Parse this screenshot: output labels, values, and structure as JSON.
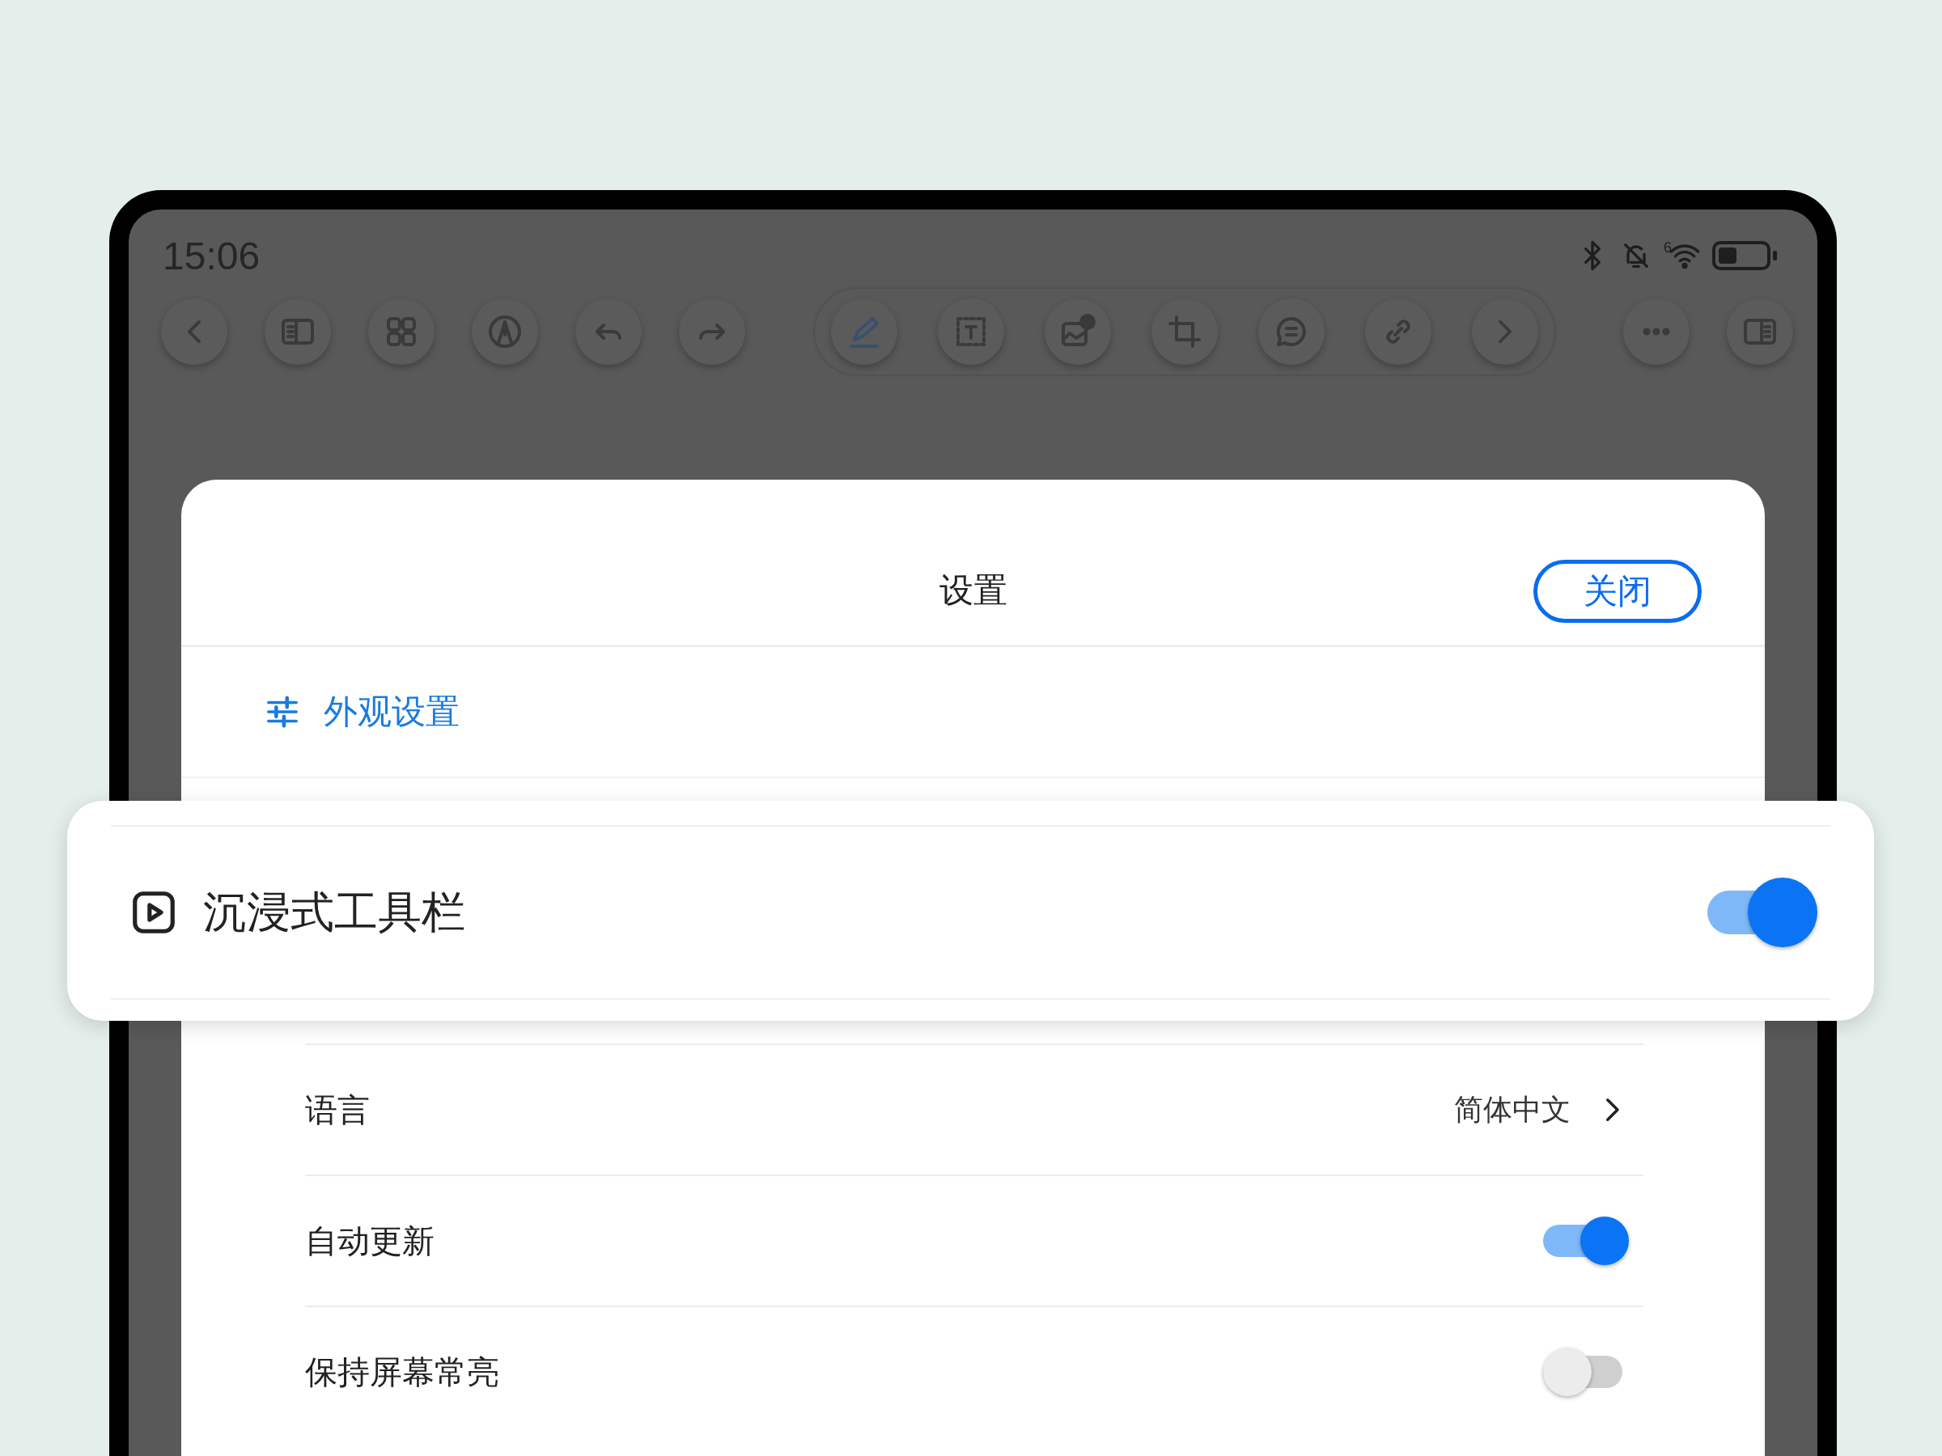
{
  "status_bar": {
    "time": "15:06",
    "wifi_badge": "6"
  },
  "toolbar": {
    "left": [
      {
        "kind": "back"
      },
      {
        "kind": "panel-left"
      },
      {
        "kind": "grid"
      },
      {
        "kind": "nib"
      },
      {
        "kind": "undo"
      },
      {
        "kind": "redo"
      }
    ],
    "tools": [
      {
        "kind": "pen",
        "selected": true
      },
      {
        "kind": "text",
        "selected": false
      },
      {
        "kind": "image-add",
        "selected": false
      },
      {
        "kind": "crop",
        "selected": false
      },
      {
        "kind": "comment",
        "selected": false
      },
      {
        "kind": "link",
        "selected": false
      },
      {
        "kind": "next",
        "selected": false
      }
    ],
    "right": [
      {
        "kind": "more"
      },
      {
        "kind": "panel-right"
      }
    ]
  },
  "dialog": {
    "title": "设置",
    "close_button": "关闭",
    "section": {
      "title": "外观设置"
    },
    "highlight": {
      "label": "沉浸式工具栏",
      "on": true
    },
    "rows": [
      {
        "kind": "link",
        "label": "语言",
        "value": "简体中文"
      },
      {
        "kind": "toggle",
        "label": "自动更新",
        "on": true
      },
      {
        "kind": "toggle",
        "label": "保持屏幕常亮",
        "on": false
      }
    ]
  }
}
